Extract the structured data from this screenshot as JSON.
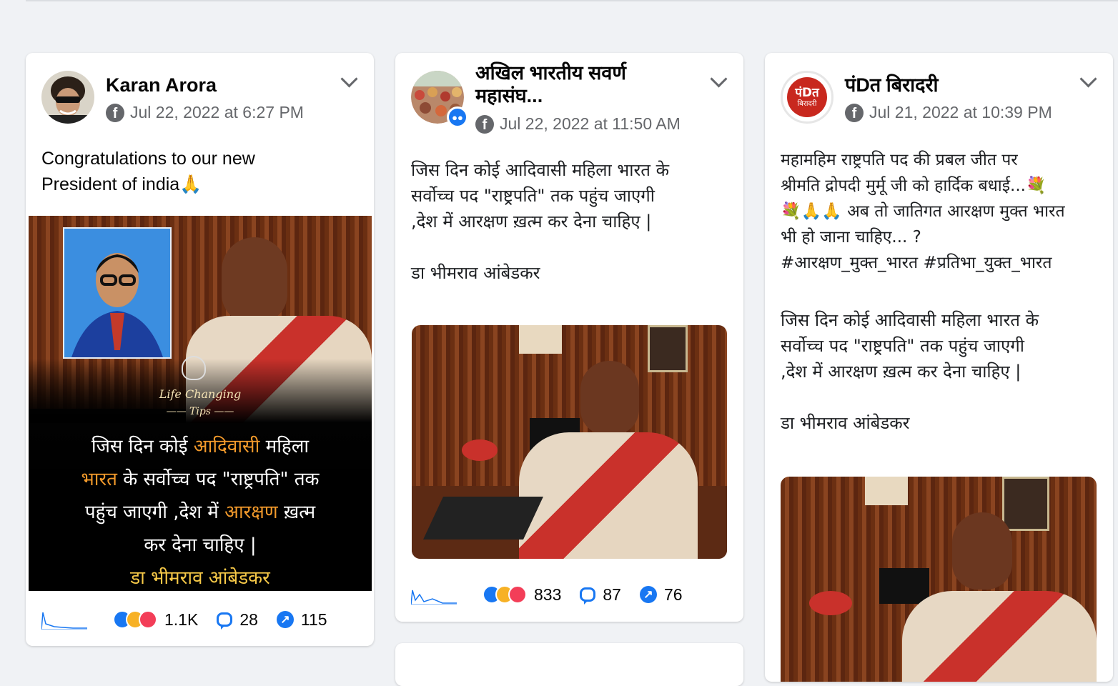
{
  "posts": [
    {
      "author": "Karan Arora",
      "date": "Jul 22, 2022 at 6:27 PM",
      "text": "Congratulations to our new\nPresident of india🙏",
      "image_text": {
        "brand_line1": "Life Changing",
        "brand_line2": "Tips",
        "quote_l1a": "जिस दिन कोई ",
        "quote_l1b": "आदिवासी",
        "quote_l1c": " महिला",
        "quote_l2a": "भारत",
        "quote_l2b": " के सर्वोच्च पद \"राष्ट्रपति\" तक",
        "quote_l3a": "पहुंच जाएगी ,देश में ",
        "quote_l3b": "आरक्षण",
        "quote_l3c": " ख़त्म",
        "quote_l4": "कर देना चाहिए |",
        "attribution": "डा भीमराव आंबेडकर"
      },
      "reactions": "1.1K",
      "comments": "28",
      "shares": "115"
    },
    {
      "author": "अखिल भारतीय सवर्ण महासंघ...",
      "date": "Jul 22, 2022 at 11:50 AM",
      "text": "जिस दिन कोई आदिवासी महिला भारत के\nसर्वोच्च पद \"राष्ट्रपति\" तक पहुंच जाएगी\n,देश में आरक्षण ख़त्म कर देना चाहिए |\n\nडा भीमराव आंबेडकर",
      "reactions": "833",
      "comments": "87",
      "shares": "76"
    },
    {
      "author": "पंDत बिरादरी",
      "avatar_text_1": "पंDत",
      "avatar_text_2": "बिरादरी",
      "date": "Jul 21, 2022 at 10:39 PM",
      "text": "महामहिम राष्ट्रपति पद की प्रबल जीत पर\nश्रीमति द्रोपदी मुर्मू जी को हार्दिक बधाई...💐\n💐🙏🙏 अब तो जातिगत आरक्षण मुक्त भारत\nभी हो जाना चाहिए... ?\n#आरक्षण_मुक्त_भारत #प्रतिभा_युक्त_भारत",
      "quote": "जिस दिन कोई आदिवासी महिला भारत के\nसर्वोच्च पद \"राष्ट्रपति\" तक पहुंच जाएगी\n,देश में आरक्षण ख़त्म कर देना चाहिए |\n\nडा भीमराव आंबेडकर"
    }
  ],
  "icons": {
    "platform": "facebook-icon",
    "menu": "chevron-down-icon",
    "comment": "comment-icon",
    "share": "share-icon",
    "group_badge": "group-icon"
  },
  "colors": {
    "accent": "#1877f2",
    "meta_text": "#65676b",
    "orange_highlight": "#f39a2b",
    "yellow_highlight": "#f7c948"
  }
}
